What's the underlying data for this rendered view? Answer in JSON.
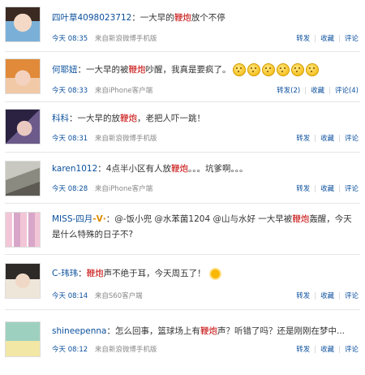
{
  "posts": [
    {
      "user": "四叶草4098023712",
      "text": [
        {
          "t": "：一大早的",
          "hl": false
        },
        {
          "t": "鞭炮",
          "hl": true
        },
        {
          "t": "放个不停",
          "hl": false
        }
      ],
      "time": "今天 08:35",
      "source": "来自新浪微博手机版",
      "repost": "转发",
      "favorite": "收藏",
      "comment": "评论"
    },
    {
      "user": "何耶妞",
      "text": [
        {
          "t": "：一大早的被",
          "hl": false
        },
        {
          "t": "鞭炮",
          "hl": true
        },
        {
          "t": "吵醒，我真是要疯了。",
          "hl": false
        }
      ],
      "emojis": 6,
      "time": "今天 08:33",
      "source": "来自iPhone客户端",
      "repost": "转发(2)",
      "favorite": "收藏",
      "comment": "评论(4)"
    },
    {
      "user": "科科",
      "text": [
        {
          "t": "：一大早的放",
          "hl": false
        },
        {
          "t": "鞭炮",
          "hl": true
        },
        {
          "t": "，老把人吓一跳！",
          "hl": false
        }
      ],
      "time": "今天 08:31",
      "source": "来自新浪微博手机版",
      "repost": "转发",
      "favorite": "收藏",
      "comment": "评论"
    },
    {
      "user": "karen1012",
      "text": [
        {
          "t": "：4点半小区有人放",
          "hl": false
        },
        {
          "t": "鞭炮",
          "hl": true
        },
        {
          "t": "。。。坑爹啊。。。",
          "hl": false
        }
      ],
      "time": "今天 08:28",
      "source": "来自iPhone客户端",
      "repost": "转发",
      "favorite": "收藏",
      "comment": "评论"
    },
    {
      "user": "MISS-四月",
      "badge": "V",
      "text": [
        {
          "t": "：@-饭小兜 @水苯菌1204 @山与水好 一大早被",
          "hl": false
        },
        {
          "t": "鞭炮",
          "hl": true
        },
        {
          "t": "轰醒，今天是什么特殊的日子不?",
          "hl": false
        }
      ],
      "time": "",
      "source": "",
      "repost": "",
      "favorite": "",
      "comment": ""
    },
    {
      "user": "C-玮玮",
      "text": [
        {
          "t": "：",
          "hl": false
        },
        {
          "t": "鞭炮",
          "hl": true
        },
        {
          "t": "声不绝于耳，今天周五了！",
          "hl": false
        }
      ],
      "sun": true,
      "time": "今天 08:14",
      "source": "来自S60客户端",
      "repost": "转发",
      "favorite": "收藏",
      "comment": "评论"
    },
    {
      "user": "shineepenna",
      "text": [
        {
          "t": "：怎么回事，篮球场上有",
          "hl": false
        },
        {
          "t": "鞭炮",
          "hl": true
        },
        {
          "t": "声？听错了吗？还是刚刚在梦中...",
          "hl": false
        }
      ],
      "time": "今天 08:12",
      "source": "来自新浪微博手机版",
      "repost": "转发",
      "favorite": "收藏",
      "comment": "评论"
    }
  ],
  "colors": {
    "link": "#0a4f9c",
    "highlight": "#c40000",
    "meta": "#888888",
    "separator": "#e6e6e6"
  }
}
